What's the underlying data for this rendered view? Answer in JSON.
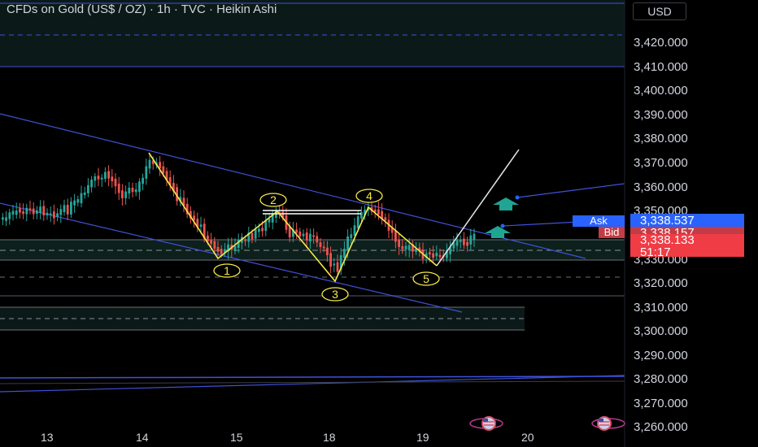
{
  "header": {
    "title": "CFDs on Gold (US$ / OZ) · 1h · TVC · Heikin Ashi",
    "currency": "USD"
  },
  "price_axis": {
    "labels": [
      "3,420.000",
      "3,410.000",
      "3,400.000",
      "3,390.000",
      "3,380.000",
      "3,370.000",
      "3,360.000",
      "3,350.000",
      "3,340.000",
      "3,330.000",
      "3,320.000",
      "3,310.000",
      "3,300.000",
      "3,290.000",
      "3,280.000",
      "3,270.000",
      "3,260.000"
    ]
  },
  "date_axis": {
    "labels": [
      "13",
      "14",
      "15",
      "18",
      "19",
      "20"
    ]
  },
  "quotes": {
    "ask_label": "Ask",
    "ask_price": "3,338.537",
    "bid_label": "Bid",
    "bid_price": "3,338.157",
    "last_price": "3,338.133",
    "countdown": "51:17"
  },
  "wave_labels": [
    "1",
    "2",
    "3",
    "4",
    "5"
  ],
  "colors": {
    "up": "#26a69a",
    "down": "#ef5350",
    "wave": "#f5e94a",
    "trendline": "#3f51d8",
    "arrow": "#1fa592",
    "ask": "#2962ff",
    "bid": "#ef5350"
  },
  "events": [
    "us-flag-icon",
    "us-flag-icon"
  ]
}
